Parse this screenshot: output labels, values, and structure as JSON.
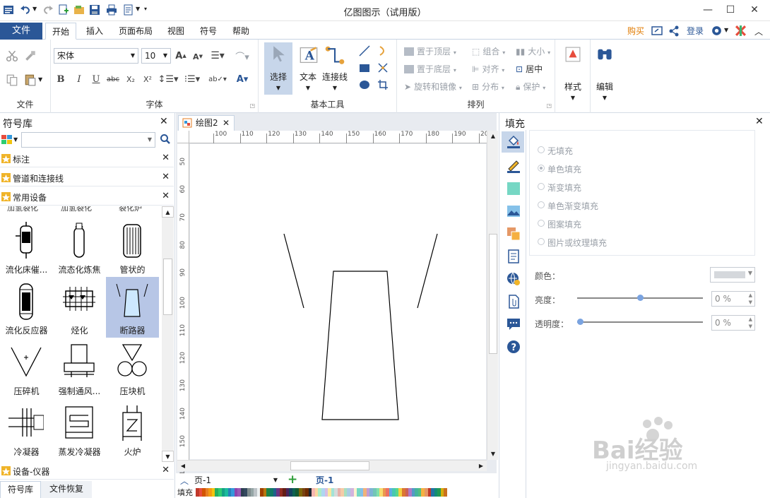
{
  "app": {
    "title": "亿图图示（试用版）"
  },
  "menu": {
    "file": "文件",
    "tabs": [
      "开始",
      "插入",
      "页面布局",
      "视图",
      "符号",
      "帮助"
    ],
    "active_tab": "开始",
    "buy": "购买",
    "login": "登录"
  },
  "ribbon": {
    "groups": {
      "file": "文件",
      "font": "字体",
      "basic_tools": "基本工具",
      "arrange": "排列"
    },
    "font_name": "宋体",
    "font_size": "10",
    "select": "选择",
    "text": "文本",
    "connector": "连接线",
    "bring_front": "置于顶层",
    "send_back": "置于底层",
    "rotate": "旋转和镜像",
    "group": "组合",
    "align": "对齐",
    "distribute": "分布",
    "size": "大小",
    "center": "居中",
    "protect": "保护",
    "style": "样式",
    "edit": "编辑"
  },
  "library": {
    "title": "符号库",
    "search_placeholder": "",
    "categories": [
      "标注",
      "管道和连接线",
      "常用设备"
    ],
    "partial_row": [
      "加氢裂化",
      "加氢裂化",
      "裂化炉"
    ],
    "shapes": [
      "流化床催...",
      "流态化炼焦",
      "管状的",
      "流化反应器",
      "烃化",
      "断路器",
      "压碎机",
      "强制通风...",
      "压块机",
      "冷凝器",
      "蒸发冷凝器",
      "火炉"
    ],
    "selected_shape": "断路器",
    "bottom_category": "设备-仪器",
    "bottom_tabs": [
      "符号库",
      "文件恢复"
    ]
  },
  "document": {
    "tab": "绘图2",
    "hruler": [
      "100",
      "110",
      "120",
      "130",
      "140",
      "150",
      "160",
      "170",
      "180",
      "190",
      "200"
    ],
    "vruler": [
      "50",
      "60",
      "70",
      "80",
      "90",
      "100",
      "110",
      "120",
      "130",
      "140",
      "150",
      "160"
    ],
    "page_select": "页-1",
    "page_tab": "页-1",
    "fill_label": "填充"
  },
  "fill_panel": {
    "title": "填充",
    "options": [
      "无填充",
      "单色填充",
      "渐变填充",
      "单色渐变填充",
      "图案填充",
      "图片或纹理填充"
    ],
    "selected": "单色填充",
    "color_label": "颜色：",
    "brightness_label": "亮度：",
    "brightness_value": "0 %",
    "brightness_level": 0.5,
    "transparency_label": "透明度：",
    "transparency_value": "0 %",
    "transparency_level": 0
  },
  "watermark": {
    "text": "Bai经验",
    "url": "jingyan.baidu.com"
  },
  "palette": [
    "#c0392b",
    "#e74c3c",
    "#d35400",
    "#e67e22",
    "#f39c12",
    "#f1c40f",
    "#27ae60",
    "#2ecc71",
    "#16a085",
    "#1abc9c",
    "#2980b9",
    "#3498db",
    "#8e44ad",
    "#9b59b6",
    "#2c3e50",
    "#34495e",
    "#7f8c8d",
    "#95a5a6",
    "#bdc3c7",
    "#ecf0f1",
    "#a04000",
    "#b9770e",
    "#1d8348",
    "#117a65",
    "#1f618d",
    "#6c3483",
    "#922b21",
    "#641e16",
    "#4a235a",
    "#154360",
    "#0e6251",
    "#145a32",
    "#7d6608",
    "#784212",
    "#6e2c00",
    "#1b2631",
    "#f5b7b1",
    "#fad7a0",
    "#abebc6",
    "#aed6f1",
    "#d7bde2",
    "#f9e79f",
    "#a3e4d7",
    "#d5dbdb",
    "#e6b0aa",
    "#f5cba7",
    "#a9dfbf",
    "#a9cce3",
    "#d2b4de",
    "#fcf3cf",
    "#76d7c4",
    "#85c1e9",
    "#f0b27a",
    "#c39bd3",
    "#7fb3d5",
    "#73c6b6",
    "#82e0aa",
    "#f7dc6f",
    "#eb984e",
    "#ec7063",
    "#5dade2",
    "#48c9b0",
    "#58d68d",
    "#f4d03f",
    "#dc7633",
    "#cd6155",
    "#af7ac5",
    "#5499c7",
    "#45b39d",
    "#52be80",
    "#f5b041",
    "#e59866",
    "#c0392b",
    "#2471a3",
    "#138d75",
    "#229954",
    "#d4ac0d",
    "#ca6f1e"
  ]
}
